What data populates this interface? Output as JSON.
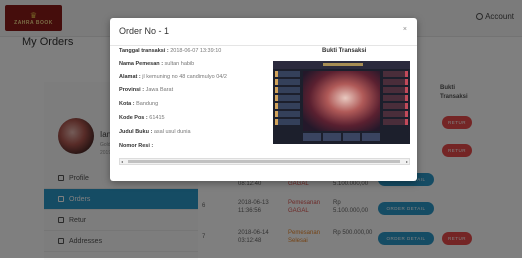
{
  "header": {
    "logo_text": "ZAHRA BOOK",
    "account_label": "Account",
    "page_title": "My Orders"
  },
  "profile": {
    "name": "Ian",
    "line1": "Gold",
    "line2": "2019"
  },
  "menu": [
    {
      "label": "Profile",
      "icon": "user-icon",
      "active": false
    },
    {
      "label": "Orders",
      "icon": "orders-icon",
      "active": true
    },
    {
      "label": "Retur",
      "icon": "retur-icon",
      "active": false
    },
    {
      "label": "Addresses",
      "icon": "address-icon",
      "active": false
    }
  ],
  "table": {
    "column_bukti": "Bukti Transaksi",
    "rows": [
      {
        "no": "",
        "date": "08:12:40",
        "status": "GAGAL",
        "status_color": "#d9534f",
        "amount": "5.100.000,00",
        "detail": "ORDER DETAIL",
        "retur": ""
      },
      {
        "no": "6",
        "date": "2018-06-13 11:36:56",
        "status": "Pemesanan GAGAL",
        "status_color": "#d9534f",
        "amount": "Rp 5.100.000,00",
        "detail": "ORDER DETAIL",
        "retur": ""
      },
      {
        "no": "7",
        "date": "2018-06-14 03:12:48",
        "status": "Pemesanan Selesai",
        "status_color": "#e8862a",
        "amount": "Rp 500.000,00",
        "detail": "ORDER DETAIL",
        "retur": "RETUR"
      }
    ],
    "upper_retur_labels": [
      "RETUR",
      "RETUR"
    ]
  },
  "modal": {
    "title": "Order No - 1",
    "close": "×",
    "fields": [
      {
        "label": "Tanggal transaksi :",
        "value": " 2018-06-07 13:39:10"
      },
      {
        "label": "Nama Pemesan :",
        "value": " sultan habib"
      },
      {
        "label": "Alamat :",
        "value": " jl kemuning no 48 candimulyo 04/2"
      },
      {
        "label": "Provinsi :",
        "value": " Jawa Barat"
      },
      {
        "label": "Kota :",
        "value": " Bandung"
      },
      {
        "label": "Kode Pos :",
        "value": " 61415"
      },
      {
        "label": "Judul Buku :",
        "value": " asal usul dunia"
      },
      {
        "label": "Nomor Resi :",
        "value": ""
      }
    ],
    "bukti_title": "Bukti Transaksi",
    "scroll_left": "◂",
    "scroll_right": "▸"
  }
}
